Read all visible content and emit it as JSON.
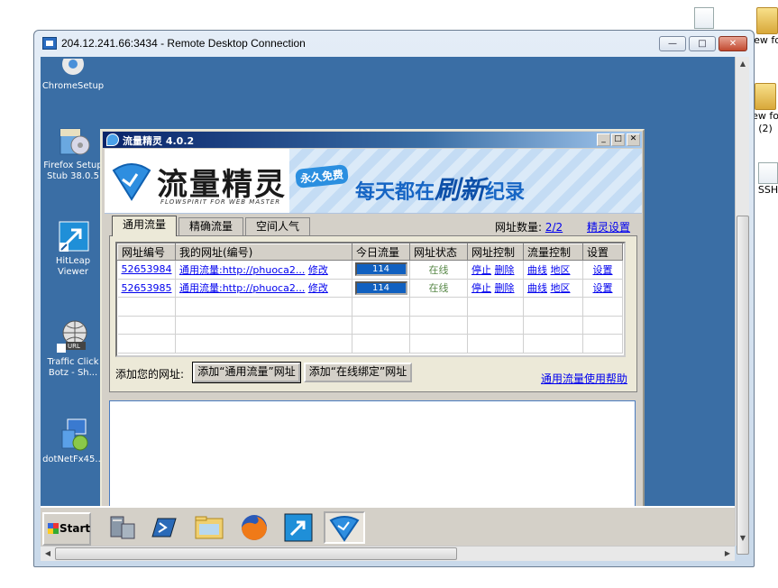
{
  "host_desktop": {
    "icons": [
      {
        "label": ""
      },
      {
        "label": "ew fo"
      },
      {
        "label": "ew fo\n(2)"
      },
      {
        "label": "SSH"
      }
    ]
  },
  "rdp": {
    "title": "204.12.241.66:3434 - Remote Desktop Connection",
    "controls": {
      "minimize": "—",
      "restore": "□",
      "close": "✕"
    }
  },
  "remote_desktop": {
    "icons": [
      {
        "label": "ChromeSetup"
      },
      {
        "label": "Firefox Setup Stub 38.0.5"
      },
      {
        "label": "HitLeap Viewer"
      },
      {
        "label": "Traffic Click Botz - Sh..."
      },
      {
        "label": "dotNetFx45..."
      }
    ]
  },
  "app": {
    "title": "流量精灵 4.0.2",
    "banner": {
      "name": "流量精灵",
      "subtitle": "FLOWSPIRIT FOR WEB MASTER",
      "free_badge": "永久免费",
      "slogan_a": "每天都在",
      "slogan_highlight": "刷新",
      "slogan_b": "纪录"
    },
    "tabs": [
      {
        "label": "通用流量"
      },
      {
        "label": "精确流量"
      },
      {
        "label": "空间人气"
      }
    ],
    "url_count_label": "网址数量:",
    "url_count_value": "2/2",
    "settings_link": "精灵设置",
    "table": {
      "headers": [
        "网址编号",
        "我的网址(编号)",
        "今日流量",
        "网址状态",
        "网址控制",
        "流量控制",
        "设置"
      ],
      "rows": [
        {
          "id": "52653984",
          "url": "通用流量:http://phuoca2...",
          "edit": "修改",
          "today": "114",
          "status": "在线",
          "stop": "停止",
          "del": "删除",
          "curve": "曲线",
          "region": "地区",
          "settings": "设置"
        },
        {
          "id": "52653985",
          "url": "通用流量:http://phuoca2...",
          "edit": "修改",
          "today": "114",
          "status": "在线",
          "stop": "停止",
          "del": "删除",
          "curve": "曲线",
          "region": "地区",
          "settings": "设置"
        }
      ]
    },
    "add_label": "添加您的网址:",
    "add_general_button": "添加“通用流量”网址",
    "add_online_button": "添加“在线绑定”网址",
    "help_link": "通用流量使用帮助"
  },
  "taskbar": {
    "start_label": "Start"
  }
}
